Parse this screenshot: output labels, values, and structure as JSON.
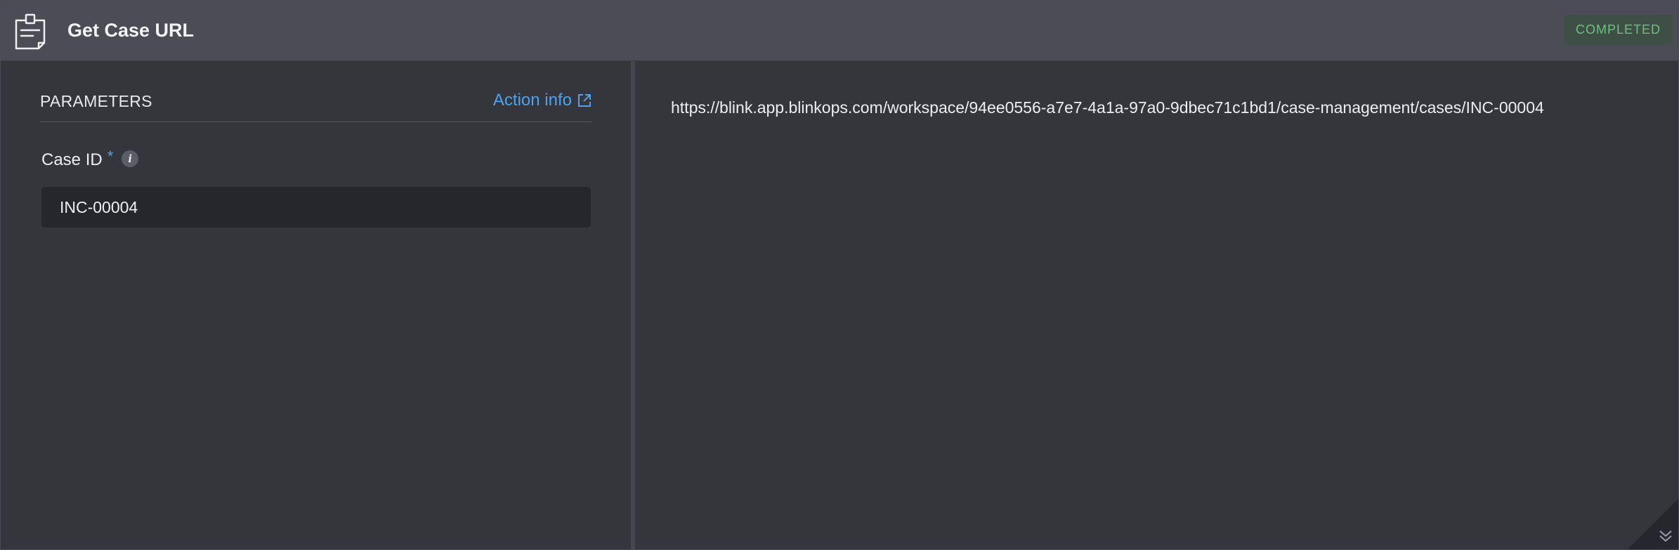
{
  "header": {
    "title": "Get Case URL",
    "icon": "clipboard-note-icon",
    "status": "COMPLETED"
  },
  "parameters": {
    "title": "PARAMETERS",
    "action_info_label": "Action info",
    "fields": [
      {
        "label": "Case ID",
        "required_marker": "*",
        "info_glyph": "i",
        "value": "INC-00004"
      }
    ]
  },
  "result": {
    "output": "https://blink.app.blinkops.com/workspace/94ee0556-a7e7-4a1a-97a0-9dbec71c1bd1/case-management/cases/INC-00004"
  },
  "colors": {
    "accent": "#4ca3f0",
    "status_text": "#6fbf7e",
    "status_bg": "#3e4f45",
    "header_bg": "#4b4c55",
    "panel_bg": "#34363c"
  }
}
